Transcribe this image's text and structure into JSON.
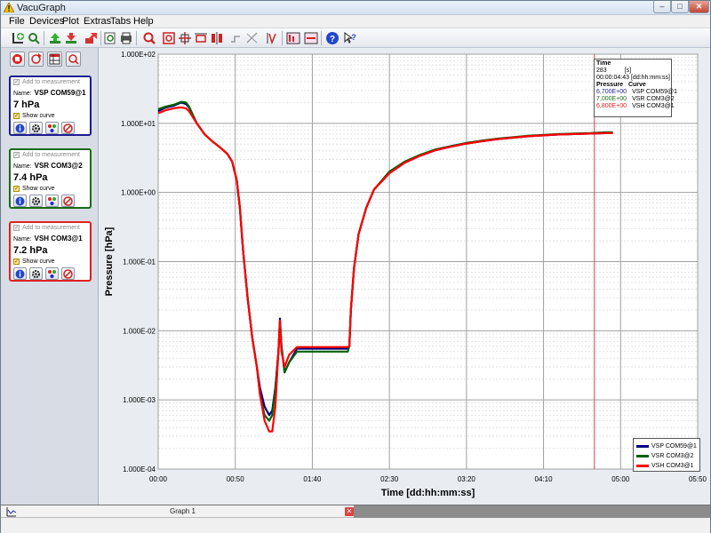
{
  "window": {
    "title": "VacuGraph"
  },
  "menu": [
    "File",
    "Devices",
    "Plot",
    "Extras",
    "Tabs",
    "Help"
  ],
  "toolbar_icons": [
    "add-device-icon",
    "search-device-icon",
    "upload-icon",
    "download-icon",
    "export-icon",
    "zoom-page-icon",
    "print-icon",
    "zoom-icon",
    "zoom-fit-icon",
    "zoom-x-icon",
    "zoom-y-icon",
    "cursor-icon",
    "measure-icon",
    "measure-diff-icon",
    "scale-icon",
    "log-scale-icon",
    "help-icon",
    "context-help-icon"
  ],
  "side_buttons": [
    "stop-icon",
    "refresh-icon",
    "table-icon",
    "zoom-reset-icon"
  ],
  "gauges": [
    {
      "add_label": "Add to measurement",
      "name_label": "Name:",
      "name": "VSP COM59@1",
      "value": "7 hPa",
      "show_label": "Show curve",
      "color": "#1c1c8f"
    },
    {
      "add_label": "Add to measurement",
      "name_label": "Name:",
      "name": "VSR COM3@2",
      "value": "7.4 hPa",
      "show_label": "Show curve",
      "color": "#1a6a1a"
    },
    {
      "add_label": "Add to measurement",
      "name_label": "Name:",
      "name": "VSH COM3@1",
      "value": "7.2 hPa",
      "show_label": "Show curve",
      "color": "#e02020"
    }
  ],
  "cursor_box": {
    "time_label": "Time",
    "time_value": "283",
    "time_unit": "[s]",
    "time_formatted": "00:00:04:43",
    "time_format": "[dd:hh:mm:ss]",
    "pressure_label": "Pressure",
    "curve_label": "Curve",
    "rows": [
      {
        "pressure": "6,700E+00",
        "curve": "VSP COM59@1",
        "color": "#1c1c8f"
      },
      {
        "pressure": "7,000E+00",
        "curve": "VSR COM3@2",
        "color": "#1a6a1a"
      },
      {
        "pressure": "6,800E+00",
        "curve": "VSH COM3@1",
        "color": "#e02020"
      }
    ]
  },
  "legend": [
    {
      "name": "VSP COM59@1",
      "color": "#00007f"
    },
    {
      "name": "VSR COM3@2",
      "color": "#005f00"
    },
    {
      "name": "VSH COM3@1",
      "color": "#ff0000"
    }
  ],
  "tab": {
    "label": "Graph 1"
  },
  "chart_data": {
    "type": "line",
    "xlabel": "Time [dd:hh:mm:ss]",
    "ylabel": "Pressure [hPa]",
    "log_y": true,
    "ylim": [
      0.0001,
      100
    ],
    "xlim_seconds": [
      0,
      350
    ],
    "x_ticks": [
      "00:00",
      "00:50",
      "01:40",
      "02:30",
      "03:20",
      "04:10",
      "05:00",
      "05:50"
    ],
    "y_ticks": [
      "1.000E+02",
      "1.000E+01",
      "1.000E+00",
      "1.000E-01",
      "1.000E-02",
      "1.000E-03",
      "1.000E-04"
    ],
    "cursor_x_seconds": 283,
    "grid": true,
    "legend_position": "bottom-right",
    "series": [
      {
        "name": "VSP COM59@1",
        "color": "#00007f",
        "points": [
          [
            0,
            15
          ],
          [
            5,
            17
          ],
          [
            10,
            18
          ],
          [
            15,
            20
          ],
          [
            18,
            19
          ],
          [
            20,
            17
          ],
          [
            25,
            10
          ],
          [
            30,
            7
          ],
          [
            35,
            5.5
          ],
          [
            40,
            4.5
          ],
          [
            45,
            3.6
          ],
          [
            48,
            2.8
          ],
          [
            51,
            1.5
          ],
          [
            53,
            0.6
          ],
          [
            55,
            0.15
          ],
          [
            58,
            0.03
          ],
          [
            61,
            0.008
          ],
          [
            64,
            0.003
          ],
          [
            66,
            0.0015
          ],
          [
            69,
            0.0008
          ],
          [
            72,
            0.0006
          ],
          [
            74,
            0.0007
          ],
          [
            76,
            0.0015
          ],
          [
            78,
            0.005
          ],
          [
            79,
            0.015
          ],
          [
            80,
            0.006
          ],
          [
            82,
            0.0025
          ],
          [
            85,
            0.0035
          ],
          [
            90,
            0.0055
          ],
          [
            100,
            0.0055
          ],
          [
            110,
            0.0055
          ],
          [
            123,
            0.0055
          ],
          [
            124,
            0.006
          ],
          [
            125,
            0.02
          ],
          [
            127,
            0.08
          ],
          [
            130,
            0.25
          ],
          [
            135,
            0.6
          ],
          [
            140,
            1.1
          ],
          [
            150,
            1.9
          ],
          [
            160,
            2.7
          ],
          [
            170,
            3.4
          ],
          [
            180,
            4.1
          ],
          [
            190,
            4.6
          ],
          [
            200,
            5.1
          ],
          [
            210,
            5.5
          ],
          [
            220,
            5.9
          ],
          [
            230,
            6.2
          ],
          [
            240,
            6.5
          ],
          [
            250,
            6.7
          ],
          [
            260,
            6.9
          ],
          [
            270,
            7.0
          ],
          [
            280,
            7.1
          ],
          [
            290,
            7.2
          ],
          [
            295,
            7.2
          ]
        ]
      },
      {
        "name": "VSR COM3@2",
        "color": "#005f00",
        "points": [
          [
            0,
            16
          ],
          [
            5,
            17.5
          ],
          [
            10,
            18.5
          ],
          [
            15,
            20.5
          ],
          [
            18,
            20
          ],
          [
            20,
            17.5
          ],
          [
            25,
            10
          ],
          [
            30,
            7
          ],
          [
            35,
            5.5
          ],
          [
            40,
            4.5
          ],
          [
            45,
            3.6
          ],
          [
            48,
            2.8
          ],
          [
            51,
            1.5
          ],
          [
            53,
            0.6
          ],
          [
            55,
            0.15
          ],
          [
            58,
            0.03
          ],
          [
            61,
            0.008
          ],
          [
            64,
            0.003
          ],
          [
            66,
            0.0012
          ],
          [
            69,
            0.0006
          ],
          [
            72,
            0.0005
          ],
          [
            74,
            0.0006
          ],
          [
            76,
            0.0014
          ],
          [
            78,
            0.005
          ],
          [
            79,
            0.014
          ],
          [
            80,
            0.006
          ],
          [
            82,
            0.0025
          ],
          [
            85,
            0.0035
          ],
          [
            90,
            0.005
          ],
          [
            100,
            0.005
          ],
          [
            110,
            0.005
          ],
          [
            123,
            0.005
          ],
          [
            124,
            0.006
          ],
          [
            125,
            0.02
          ],
          [
            127,
            0.08
          ],
          [
            130,
            0.25
          ],
          [
            135,
            0.6
          ],
          [
            140,
            1.1
          ],
          [
            150,
            2.0
          ],
          [
            160,
            2.8
          ],
          [
            170,
            3.5
          ],
          [
            180,
            4.2
          ],
          [
            190,
            4.7
          ],
          [
            200,
            5.2
          ],
          [
            210,
            5.6
          ],
          [
            220,
            6.0
          ],
          [
            230,
            6.3
          ],
          [
            240,
            6.6
          ],
          [
            250,
            6.8
          ],
          [
            260,
            7.0
          ],
          [
            270,
            7.1
          ],
          [
            280,
            7.2
          ],
          [
            290,
            7.4
          ],
          [
            295,
            7.4
          ]
        ]
      },
      {
        "name": "VSH COM3@1",
        "color": "#ff0000",
        "points": [
          [
            0,
            14
          ],
          [
            5,
            15.5
          ],
          [
            10,
            16.5
          ],
          [
            15,
            17
          ],
          [
            18,
            16.5
          ],
          [
            20,
            15
          ],
          [
            25,
            10
          ],
          [
            30,
            7
          ],
          [
            35,
            5.5
          ],
          [
            40,
            4.5
          ],
          [
            45,
            3.6
          ],
          [
            48,
            2.8
          ],
          [
            51,
            1.5
          ],
          [
            53,
            0.6
          ],
          [
            55,
            0.15
          ],
          [
            58,
            0.03
          ],
          [
            61,
            0.008
          ],
          [
            64,
            0.003
          ],
          [
            66,
            0.0012
          ],
          [
            69,
            0.0005
          ],
          [
            72,
            0.00035
          ],
          [
            74,
            0.00035
          ],
          [
            76,
            0.0008
          ],
          [
            78,
            0.005
          ],
          [
            79,
            0.014
          ],
          [
            80,
            0.005
          ],
          [
            82,
            0.003
          ],
          [
            85,
            0.0045
          ],
          [
            90,
            0.0058
          ],
          [
            100,
            0.0058
          ],
          [
            110,
            0.0058
          ],
          [
            123,
            0.0058
          ],
          [
            124,
            0.006
          ],
          [
            125,
            0.02
          ],
          [
            127,
            0.08
          ],
          [
            130,
            0.25
          ],
          [
            135,
            0.6
          ],
          [
            140,
            1.1
          ],
          [
            150,
            1.9
          ],
          [
            160,
            2.7
          ],
          [
            170,
            3.4
          ],
          [
            180,
            4.1
          ],
          [
            190,
            4.6
          ],
          [
            200,
            5.1
          ],
          [
            210,
            5.5
          ],
          [
            220,
            5.9
          ],
          [
            230,
            6.2
          ],
          [
            240,
            6.5
          ],
          [
            250,
            6.7
          ],
          [
            260,
            6.9
          ],
          [
            270,
            7.0
          ],
          [
            280,
            7.1
          ],
          [
            290,
            7.2
          ],
          [
            295,
            7.2
          ]
        ]
      }
    ]
  }
}
